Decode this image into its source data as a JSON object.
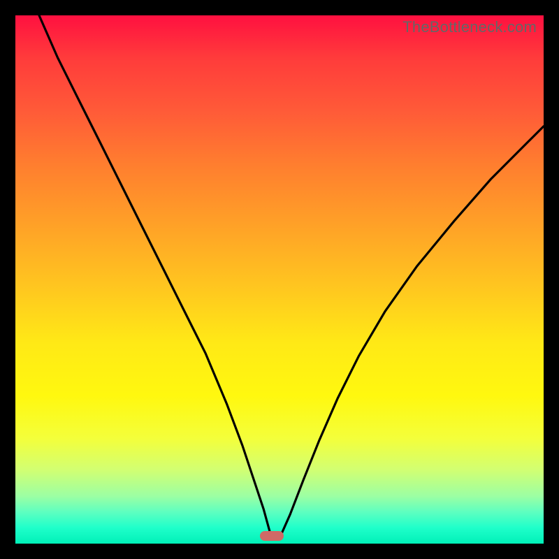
{
  "watermark": "TheBottleneck.com",
  "marker": {
    "x_frac": 0.485,
    "y_frac": 0.985
  },
  "colors": {
    "frame": "#000000",
    "curve": "#000000",
    "marker": "#cf6a66",
    "watermark": "#666666",
    "gradient_stops": [
      "#ff1040",
      "#ff3b3b",
      "#ff5a38",
      "#ff7d2f",
      "#ffa227",
      "#ffc81f",
      "#ffe916",
      "#fff80f",
      "#f4ff3a",
      "#d2ff72",
      "#9cffa3",
      "#5effc0",
      "#1fffca",
      "#00f0b8"
    ]
  },
  "chart_data": {
    "type": "line",
    "title": "",
    "xlabel": "",
    "ylabel": "",
    "xlim": [
      0,
      1
    ],
    "ylim": [
      0,
      1
    ],
    "annotations": [
      "TheBottleneck.com"
    ],
    "notes": "V-shaped bottleneck curve over red-to-green vertical gradient; axes unlabeled; minimum near x≈0.49.",
    "marker": {
      "x": 0.485,
      "y": 0.008
    },
    "series": [
      {
        "name": "bottleneck-curve",
        "x": [
          0.045,
          0.08,
          0.12,
          0.16,
          0.2,
          0.24,
          0.28,
          0.32,
          0.36,
          0.4,
          0.43,
          0.45,
          0.47,
          0.485,
          0.5,
          0.52,
          0.545,
          0.575,
          0.61,
          0.65,
          0.7,
          0.76,
          0.83,
          0.9,
          0.97,
          1.0
        ],
        "y": [
          1.0,
          0.92,
          0.84,
          0.76,
          0.68,
          0.6,
          0.52,
          0.44,
          0.36,
          0.265,
          0.185,
          0.125,
          0.065,
          0.01,
          0.01,
          0.055,
          0.12,
          0.195,
          0.275,
          0.355,
          0.44,
          0.525,
          0.61,
          0.69,
          0.76,
          0.79
        ]
      }
    ]
  }
}
